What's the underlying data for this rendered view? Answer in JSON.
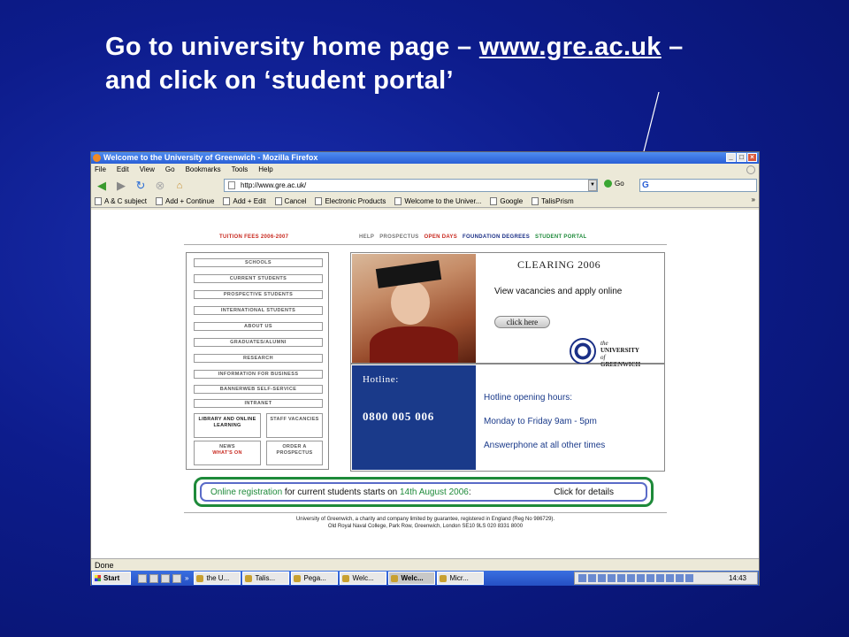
{
  "slide": {
    "title_before": "Go to university home page – ",
    "title_link": "www.gre.ac.uk",
    "title_after": " – and click on ‘student portal’"
  },
  "browser": {
    "window_title": "Welcome to the University of Greenwich - Mozilla Firefox",
    "menu": [
      "File",
      "Edit",
      "View",
      "Go",
      "Bookmarks",
      "Tools",
      "Help"
    ],
    "url": "http://www.gre.ac.uk/",
    "go_label": "Go",
    "bookmarks": [
      "A & C subject",
      "Add + Continue",
      "Add + Edit",
      "Cancel",
      "Electronic Products",
      "Welcome to the Univer...",
      "Google",
      "TalisPrism"
    ],
    "bookmarks_more": "»",
    "status": "Done"
  },
  "site": {
    "topnav": {
      "fees": "TUITION FEES 2006-2007",
      "help": "HELP",
      "prospectus": "PROSPECTUS",
      "open_days": "OPEN DAYS",
      "foundation": "FOUNDATION DEGREES",
      "student_portal": "STUDENT PORTAL"
    },
    "menu_items": [
      "SCHOOLS",
      "CURRENT STUDENTS",
      "PROSPECTIVE STUDENTS",
      "INTERNATIONAL STUDENTS",
      "ABOUT US",
      "GRADUATES/ALUMNI",
      "RESEARCH",
      "INFORMATION FOR BUSINESS",
      "BANNERWEB SELF-SERVICE",
      "INTRANET"
    ],
    "boxes": {
      "library": "LIBRARY AND ONLINE LEARNING",
      "staff": "STAFF VACANCIES",
      "news": "NEWS",
      "whats_on": "WHAT'S ON",
      "order": "ORDER A PROSPECTUS"
    },
    "clearing": {
      "title": "CLEARING 2006",
      "text": "View vacancies and apply online",
      "button": "click here"
    },
    "uni": {
      "the": "the",
      "line1": "UNIVERSITY",
      "of": "of",
      "line2": "GREENWICH"
    },
    "hotline": {
      "label": "Hotline:",
      "number": "0800 005 006",
      "hours_title": "Hotline opening hours:",
      "hours": "Monday to Friday 9am - 5pm",
      "answerphone": "Answerphone at all other times"
    },
    "registration": {
      "part1": "Online registration",
      "part2": " for current students starts on ",
      "date": "14th August 2006",
      "part3": ":",
      "details": "Click for details"
    },
    "footer": {
      "line1": "University of Greenwich, a charity and company limited by guarantee, registered in England (Reg No 986729).",
      "line2": "Old Royal Naval College, Park Row, Greenwich, London SE10 9LS   020 8331 8000"
    }
  },
  "taskbar": {
    "start": "Start",
    "quick_more": "»",
    "tasks": [
      "the U...",
      "Talis...",
      "Pega...",
      "Welc...",
      "Welc...",
      "Micr..."
    ],
    "clock": "14:43"
  }
}
